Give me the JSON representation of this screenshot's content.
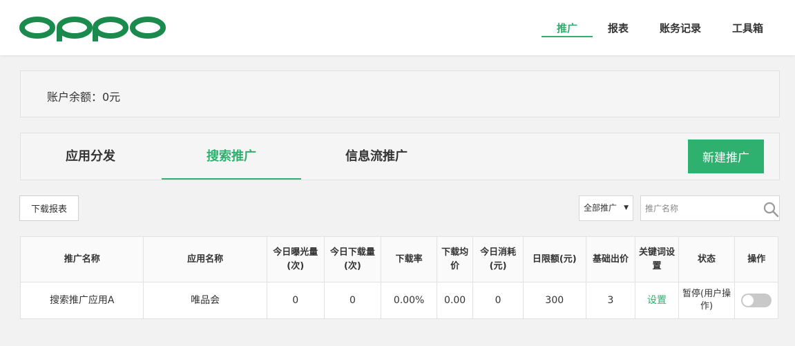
{
  "brand": {
    "logo_text": "OPPO",
    "accent": "#2eb06e",
    "logo_color": "#1a8a4d"
  },
  "nav": {
    "items": [
      {
        "label": "推广",
        "active": true
      },
      {
        "label": "报表"
      },
      {
        "label": "账务记录"
      },
      {
        "label": "工具箱"
      }
    ]
  },
  "balance": {
    "text": "账户余额：0元"
  },
  "tabs": {
    "items": [
      {
        "label": "应用分发"
      },
      {
        "label": "搜索推广",
        "active": true
      },
      {
        "label": "信息流推广"
      }
    ],
    "new_button": "新建推广"
  },
  "toolbar": {
    "download_label": "下载报表",
    "filter_value": "全部推广",
    "search_placeholder": "推广名称",
    "search_icon": "search-icon"
  },
  "table": {
    "headers": [
      "推广名称",
      "应用名称",
      "今日曝光量(次)",
      "今日下载量(次)",
      "下载率",
      "下载均价",
      "今日消耗(元)",
      "日限额(元)",
      "基础出价",
      "关键词设置",
      "状态",
      "操作"
    ],
    "rows": [
      {
        "name": "搜索推广应用A",
        "app": "唯品会",
        "impressions": "0",
        "downloads": "0",
        "rate": "0.00%",
        "avg_price": "0.00",
        "spend": "0",
        "daily_limit": "300",
        "base_bid": "3",
        "keyword": "设置",
        "status": "暂停(用户操作)",
        "toggle_on": false
      }
    ]
  }
}
